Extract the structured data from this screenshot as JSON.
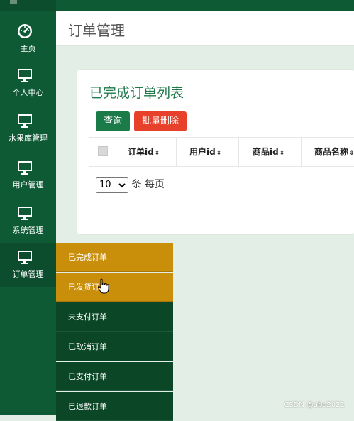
{
  "sidebar": {
    "items": [
      {
        "label": "主页",
        "icon": "dashboard-icon"
      },
      {
        "label": "个人中心",
        "icon": "monitor-icon"
      },
      {
        "label": "水果库管理",
        "icon": "monitor-icon"
      },
      {
        "label": "用户管理",
        "icon": "monitor-icon"
      },
      {
        "label": "系统管理",
        "icon": "monitor-icon"
      },
      {
        "label": "订单管理",
        "icon": "monitor-icon"
      }
    ]
  },
  "header": {
    "title": "订单管理"
  },
  "card": {
    "title": "已完成订单列表",
    "buttons": {
      "query": "查询",
      "batch_delete": "批量删除"
    },
    "table": {
      "columns": [
        "订单id",
        "用户id",
        "商品id",
        "商品名称"
      ],
      "sort_glyph": "⇕"
    },
    "pager": {
      "page_size": "10",
      "suffix": "条 每页"
    }
  },
  "submenu": {
    "items": [
      "已完成订单",
      "已发货订单",
      "未支付订单",
      "已取消订单",
      "已支付订单",
      "已退款订单"
    ]
  },
  "watermark": "CSDN @abo2021",
  "colors": {
    "sidebar": "#0d5a35",
    "accent_green": "#1a7a48",
    "danger": "#e8412b",
    "highlight": "#c98e0a"
  }
}
